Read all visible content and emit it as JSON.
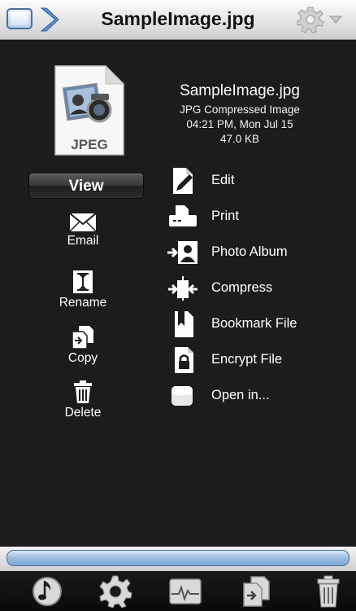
{
  "header": {
    "title": "SampleImage.jpg"
  },
  "file": {
    "icon_label": "JPEG",
    "name": "SampleImage.jpg",
    "kind": "JPG Compressed Image",
    "modified": "04:21 PM, Mon Jul 15",
    "size": "47.0  KB"
  },
  "view_button": "View",
  "left_actions": [
    {
      "label": "Email",
      "icon": "envelope-icon"
    },
    {
      "label": "Rename",
      "icon": "text-cursor-icon"
    },
    {
      "label": "Copy",
      "icon": "copy-icon"
    },
    {
      "label": "Delete",
      "icon": "trash-icon"
    }
  ],
  "right_actions": [
    {
      "label": "Edit",
      "icon": "pen-document-icon"
    },
    {
      "label": "Print",
      "icon": "printer-icon"
    },
    {
      "label": "Photo Album",
      "icon": "photo-album-icon"
    },
    {
      "label": "Compress",
      "icon": "compress-icon"
    },
    {
      "label": "Bookmark File",
      "icon": "bookmark-icon"
    },
    {
      "label": "Encrypt File",
      "icon": "lock-document-icon"
    },
    {
      "label": "Open in...",
      "icon": "open-in-icon"
    }
  ],
  "tabbar": [
    "music-icon",
    "gear-icon",
    "activity-monitor-icon",
    "copy-icon",
    "trash-icon"
  ],
  "colors": {
    "background": "#1c1c1c",
    "header": "#e6e6e6",
    "status_bar": "#9bbbe0",
    "window_icon": "#4a6fa0"
  }
}
